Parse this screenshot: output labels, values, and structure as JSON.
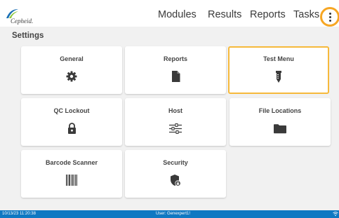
{
  "header": {
    "logo_text": "Cepheid.",
    "nav": [
      {
        "label": "Modules"
      },
      {
        "label": "Results"
      },
      {
        "label": "Reports"
      },
      {
        "label": "Tasks"
      }
    ],
    "menu_icon": "more-vertical-icon"
  },
  "page": {
    "title": "Settings"
  },
  "tiles": [
    {
      "label": "General",
      "icon": "gear-icon"
    },
    {
      "label": "Reports",
      "icon": "document-icon"
    },
    {
      "label": "Test Menu",
      "icon": "test-cartridge-icon",
      "selected": true
    },
    {
      "label": "QC Lockout",
      "icon": "lock-icon"
    },
    {
      "label": "Host",
      "icon": "sliders-icon"
    },
    {
      "label": "File Locations",
      "icon": "folder-icon"
    },
    {
      "label": "Barcode Scanner",
      "icon": "barcode-icon"
    },
    {
      "label": "Security",
      "icon": "shield-lock-icon"
    }
  ],
  "status": {
    "timestamp": "10/13/23 11:20:38",
    "user": "User: Genexpert1!",
    "network_icon": "wifi-icon"
  },
  "colors": {
    "accent_orange": "#f6a623",
    "status_blue": "#0f78c2",
    "background": "#f1f1f1"
  }
}
